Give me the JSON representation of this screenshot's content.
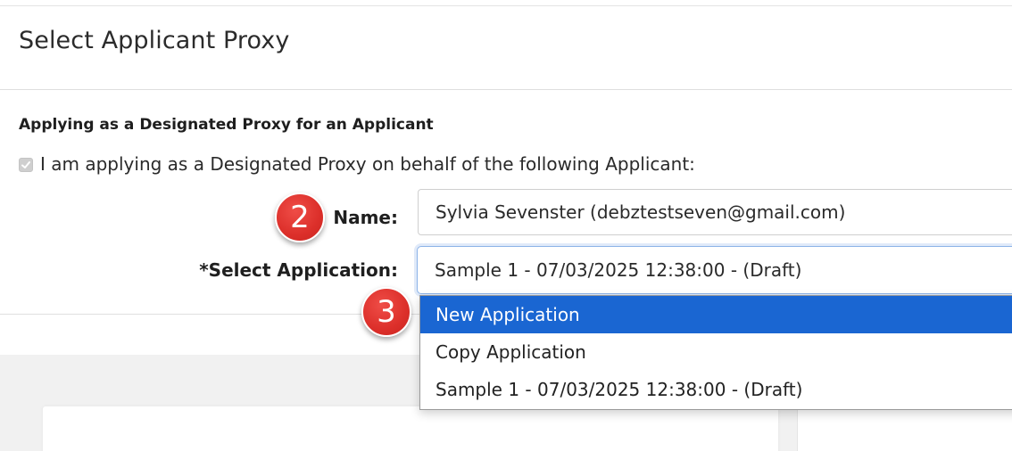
{
  "page": {
    "title": "Select Applicant Proxy"
  },
  "proxy_section": {
    "heading": "Applying as a Designated Proxy for an Applicant",
    "checkbox_label": "I am applying as a Designated Proxy on behalf of the following Applicant:",
    "checkbox_checked": true
  },
  "form": {
    "name_label": "Name:",
    "name_value": "Sylvia Sevenster (debztestseven@gmail.com)",
    "application_label": "*Select Application:",
    "application_selected": "Sample 1 - 07/03/2025 12:38:00 - (Draft)"
  },
  "dropdown": {
    "options": [
      {
        "label": "New Application",
        "highlighted": true
      },
      {
        "label": "Copy Application",
        "highlighted": false
      },
      {
        "label": "Sample 1 - 07/03/2025 12:38:00 - (Draft)",
        "highlighted": false
      }
    ]
  },
  "markers": {
    "step_name": "2",
    "step_application": "3"
  },
  "colors": {
    "highlight": "#1a66d2",
    "marker": "#dc2f2a"
  }
}
